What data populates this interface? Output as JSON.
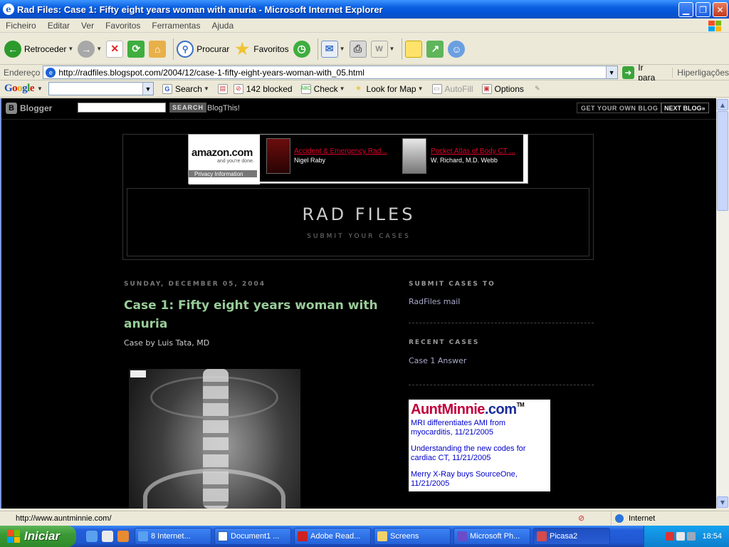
{
  "window": {
    "title": "Rad Files: Case 1: Fifty eight years woman with anuria - Microsoft Internet Explorer"
  },
  "menu": [
    "Ficheiro",
    "Editar",
    "Ver",
    "Favoritos",
    "Ferramentas",
    "Ajuda"
  ],
  "toolbar": {
    "back": "Retroceder",
    "search": "Procurar",
    "favorites": "Favoritos"
  },
  "address": {
    "label": "Endereço",
    "url": "http://radfiles.blogspot.com/2004/12/case-1-fifty-eight-years-woman-with_05.html",
    "go": "Ir para",
    "links": "Hiperligações"
  },
  "googlebar": {
    "logo": "Google",
    "search": "Search",
    "blocked": "142 blocked",
    "check": "Check",
    "lookup": "Look for Map",
    "autofill": "AutoFill",
    "options": "Options"
  },
  "blogger_nav": {
    "logo": "Blogger",
    "search_btn": "SEARCH",
    "blogthis": "BlogThis!",
    "get_blog": "GET YOUR OWN BLOG",
    "next_blog": "NEXT BLOG»"
  },
  "ad": {
    "amazon": "amazon.com",
    "amazon_tag": "and you're done.",
    "privacy": "Privacy Information",
    "books": [
      {
        "title": "Accident & Emergency Rad...",
        "author": "Nigel Raby"
      },
      {
        "title": "Pocket Atlas of Body CT ...",
        "author": "W. Richard, M.D. Webb"
      }
    ]
  },
  "blog": {
    "title": "RAD FILES",
    "description": "SUBMIT YOUR CASES"
  },
  "post": {
    "date": "SUNDAY, DECEMBER 05, 2004",
    "title": "Case 1: Fifty eight years woman with anuria",
    "byline": "Case by Luis Tata, MD"
  },
  "sidebar": {
    "submit_heading": "SUBMIT CASES TO",
    "submit_link": "RadFiles mail",
    "recent_heading": "RECENT CASES",
    "recent_link": "Case 1 Answer",
    "auntminnie": {
      "logo_a": "AuntMinnie",
      "logo_b": ".com",
      "tm": "TM",
      "news": [
        "MRI differentiates AMI from myocarditis, 11/21/2005",
        "Understanding the new codes for cardiac CT, 11/21/2005",
        "Merry X-Ray buys SourceOne, 11/21/2005"
      ]
    }
  },
  "status": {
    "text": "http://www.auntminnie.com/",
    "zone": "Internet"
  },
  "taskbar": {
    "start": "Iniciar",
    "tasks": [
      "8 Internet...",
      "Document1 ...",
      "Adobe Read...",
      "Screens",
      "Microsoft Ph...",
      "Picasa2"
    ],
    "clock": "18:54"
  },
  "colors": {
    "post_title": "#99cc99",
    "link": "#aaaacc",
    "titlebar": "#0553d6"
  }
}
